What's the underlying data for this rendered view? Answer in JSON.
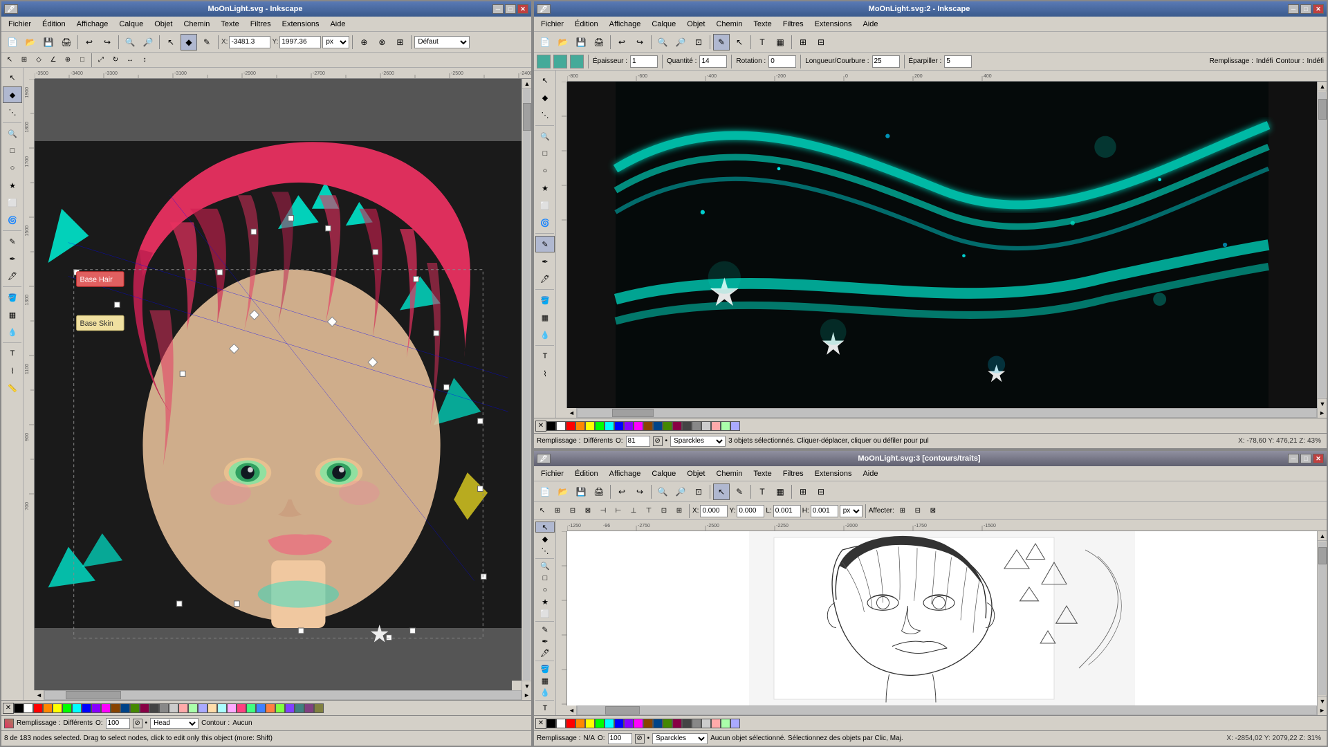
{
  "left_window": {
    "title": "MoOnLight.svg - Inkscape",
    "menus": [
      "Fichier",
      "Édition",
      "Affichage",
      "Calque",
      "Objet",
      "Chemin",
      "Texte",
      "Filtres",
      "Extensions",
      "Aide"
    ],
    "toolbar": {
      "x_label": "X:",
      "x_value": "-3481.3",
      "y_label": "Y:",
      "y_value": "1997.36",
      "unit": "px",
      "preset": "Défaut"
    },
    "snap_bar_visible": true,
    "layers": [
      "Base Hair",
      "Base Skin"
    ],
    "status": "8 de 183 nodes selected. Drag to select nodes, click to edit only this object (more: Shift)",
    "fill_label": "Remplissage :",
    "fill_value": "Différents",
    "fill_opacity": "100",
    "contour_label": "Contour :",
    "contour_value": "Aucun",
    "brush_preset": "Head",
    "coords_bottom": ""
  },
  "right_top_window": {
    "title": "MoOnLight.svg:2 - Inkscape",
    "menus": [
      "Fichier",
      "Édition",
      "Affichage",
      "Calque",
      "Objet",
      "Chemin",
      "Texte",
      "Filtres",
      "Extensions",
      "Aide"
    ],
    "mode_bar": {
      "epaisseur_label": "Épaisseur :",
      "epaisseur_value": "1",
      "quantite_label": "Quantité :",
      "quantite_value": "14",
      "rotation_label": "Rotation :",
      "rotation_value": "0",
      "longueur_label": "Longueur/Courbure :",
      "longueur_value": "25",
      "eparpiller_label": "Éparpiller :",
      "eparpiller_value": "5",
      "remplissage_label": "Remplissage :",
      "remplissage_value": "Indéfi",
      "contour_label": "Contour :",
      "contour_value": "Indéfi"
    },
    "fill_label": "Remplissage :",
    "fill_value": "Différents",
    "contour_label": "Contour :",
    "contour_value": "p Indéfini",
    "brush_preset": "Sparckles",
    "status_text": "3 objets sélectionnés. Cliquer-déplacer, cliquer ou défiler pour pul",
    "coords": "X: -78,60   Y: 476,21   Z: 43%"
  },
  "right_bottom_window": {
    "title": "MoOnLight.svg:3 [contours/traits]",
    "menus": [
      "Fichier",
      "Édition",
      "Affichage",
      "Calque",
      "Objet",
      "Chemin",
      "Texte",
      "Filtres",
      "Extensions",
      "Aide"
    ],
    "x_label": "X:",
    "x_value": "0.000",
    "y_label": "Y:",
    "y_value": "0.000",
    "l_label": "L:",
    "l_value": "0.001",
    "h_label": "H:",
    "h_value": "0.001",
    "unit": "px",
    "affecter_label": "Affecter:",
    "fill_label": "Remplissage :",
    "fill_value": "N/A",
    "contour_label": "Contour :",
    "contour_value": "",
    "brush_preset": "Sparckles",
    "opacity": "100",
    "status_text": "Aucun objet sélectionné. Sélectionnez des objets par Clic, Maj.",
    "coords": "X: -2854,02   Y: 2079,22   Z: 31%"
  },
  "colors_left": [
    "#000000",
    "#ffffff",
    "#ff0000",
    "#00ff00",
    "#0000ff",
    "#ffff00",
    "#ff00ff",
    "#00ffff",
    "#ff8800",
    "#8800ff",
    "#00ff88",
    "#ff0088",
    "#888888",
    "#444444",
    "#cccccc",
    "#884400",
    "#004488",
    "#448800",
    "#880044",
    "#004444",
    "#440000",
    "#000044",
    "#440044",
    "#008844",
    "#ff4444",
    "#44ff44",
    "#4444ff",
    "#ffaa44",
    "#aa44ff",
    "#44ffaa",
    "#ff44aa",
    "#aaffaa"
  ],
  "colors_right": [
    "#000000",
    "#ffffff",
    "#ff0000",
    "#00ff00",
    "#0000ff",
    "#ffff00",
    "#ff00ff",
    "#00ffff",
    "#ff8800",
    "#8800ff",
    "#00ff88",
    "#ff0088",
    "#888888",
    "#444444",
    "#cccccc",
    "#884400",
    "#004488",
    "#448800",
    "#880044",
    "#004444"
  ],
  "icons": {
    "close": "✕",
    "minimize": "─",
    "maximize": "□",
    "arrow": "▶",
    "node": "◆",
    "pencil": "✏",
    "select": "↖",
    "zoom": "🔍",
    "fill": "■",
    "eye": "👁"
  },
  "tool_icons": [
    "↖",
    "✦",
    "◻",
    "✎",
    "⊙",
    "⬟",
    "⋯",
    "T",
    "✏",
    "🪣",
    "🔍",
    "📐",
    "✂",
    "⤢",
    "⊕",
    "📏",
    "✒",
    "∿",
    "✦",
    "⋯"
  ],
  "titlebar_btn_labels": [
    "─",
    "□",
    "✕"
  ]
}
